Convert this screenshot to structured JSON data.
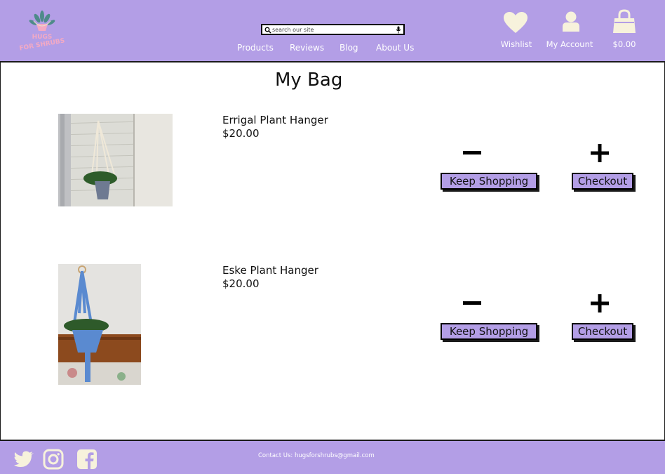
{
  "brand": {
    "logo_text_1": "HUGS",
    "logo_text_2": "FOR SHRUBS"
  },
  "search": {
    "placeholder": "search our site"
  },
  "nav": {
    "items": [
      {
        "label": "Products"
      },
      {
        "label": "Reviews"
      },
      {
        "label": "Blog"
      },
      {
        "label": "About Us"
      }
    ]
  },
  "header_actions": {
    "wishlist": "Wishlist",
    "account": "My Account",
    "cart_total": "$0.00"
  },
  "page": {
    "title": "My Bag"
  },
  "bag_items": [
    {
      "name": "Errigal Plant Hanger",
      "price": "$20.00",
      "keep_shopping": "Keep Shopping",
      "checkout": "Checkout"
    },
    {
      "name": "Eske Plant Hanger",
      "price": "$20.00",
      "keep_shopping": "Keep Shopping",
      "checkout": "Checkout"
    }
  ],
  "footer": {
    "contact": "Contact Us: hugsforshrubs@gmail.com",
    "social": [
      "twitter-icon",
      "instagram-icon",
      "facebook-icon"
    ]
  },
  "colors": {
    "accent": "#b39ee6",
    "icon_cream": "#f7f2dc",
    "logo_pink": "#f3a9c4"
  }
}
